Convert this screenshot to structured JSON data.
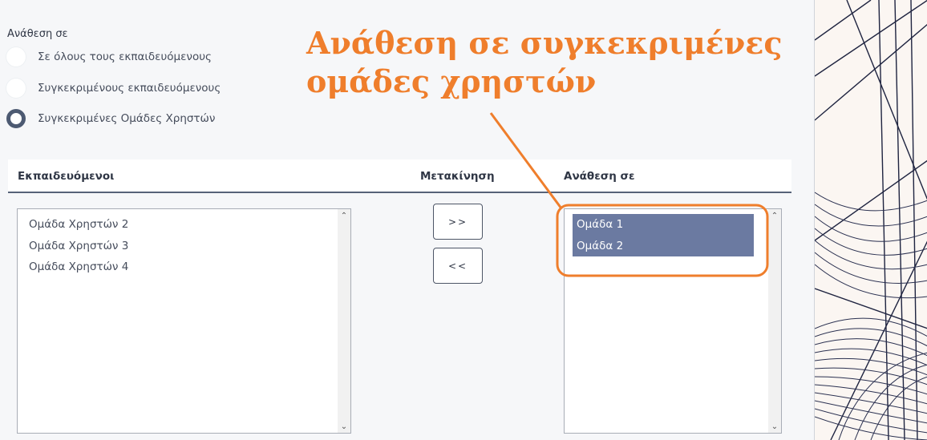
{
  "assignment": {
    "label": "Ανάθεση σε",
    "options": [
      {
        "label": "Σε όλους τους εκπαιδευόμενους",
        "checked": false
      },
      {
        "label": "Συγκεκριμένους εκπαιδευόμενους",
        "checked": false
      },
      {
        "label": "Συγκεκριμένες Ομάδες Χρηστών",
        "checked": true
      }
    ]
  },
  "table": {
    "col_left": "Εκπαιδευόμενοι",
    "col_move": "Μετακίνηση",
    "col_right": "Ανάθεση σε"
  },
  "left_list": [
    "Ομάδα Χρηστών 2",
    "Ομάδα Χρηστών 3",
    "Ομάδα Χρηστών 4"
  ],
  "right_list": [
    "Ομάδα 1",
    "Ομάδα 2"
  ],
  "buttons": {
    "move_right": ">>",
    "move_left": "<<"
  },
  "annotation": {
    "line1": "Ανάθεση σε συγκεκριμένες",
    "line2": "ομάδες χρηστών",
    "color": "#ef7e2c"
  },
  "colors": {
    "selection": "#6b7aa1",
    "radio_checked": "#4d5a72"
  }
}
